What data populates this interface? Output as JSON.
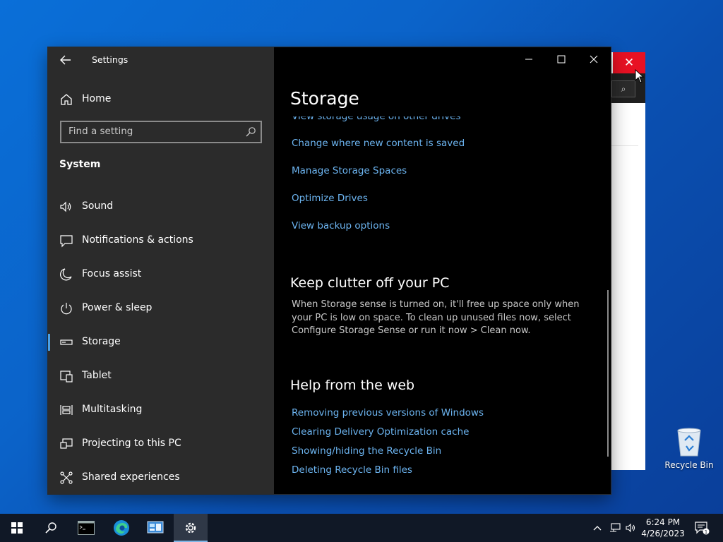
{
  "window": {
    "title": "Settings",
    "minimize_label": "—",
    "maximize_label": "☐",
    "close_label": "✕"
  },
  "sidebar": {
    "home_label": "Home",
    "search_placeholder": "Find a setting",
    "section_title": "System",
    "items": [
      {
        "label": "Sound",
        "icon": "speaker-icon"
      },
      {
        "label": "Notifications & actions",
        "icon": "notification-icon"
      },
      {
        "label": "Focus assist",
        "icon": "moon-icon"
      },
      {
        "label": "Power & sleep",
        "icon": "power-icon"
      },
      {
        "label": "Storage",
        "icon": "storage-icon",
        "active": true
      },
      {
        "label": "Tablet",
        "icon": "tablet-icon"
      },
      {
        "label": "Multitasking",
        "icon": "multitasking-icon"
      },
      {
        "label": "Projecting to this PC",
        "icon": "projecting-icon"
      },
      {
        "label": "Shared experiences",
        "icon": "shared-experiences-icon"
      }
    ]
  },
  "main": {
    "title": "Storage",
    "storage_links": [
      "View storage usage on other drives",
      "Change where new content is saved",
      "Manage Storage Spaces",
      "Optimize Drives",
      "View backup options"
    ],
    "clutter_heading": "Keep clutter off your PC",
    "clutter_text": "When Storage sense is turned on, it'll free up space only when your PC is low on space. To clean up unused files now, select Configure Storage Sense or run it now > Clean now.",
    "help_heading": "Help from the web",
    "help_links": [
      "Removing previous versions of Windows",
      "Clearing Delivery Optimization cache",
      "Showing/hiding the Recycle Bin",
      "Deleting Recycle Bin files"
    ]
  },
  "desktop": {
    "recycle_bin_label": "Recycle Bin"
  },
  "taskbar": {
    "time": "6:24 PM",
    "date": "4/26/2023",
    "notification_count": "1"
  },
  "colors": {
    "accent": "#4aa0e6",
    "link": "#6cb4f0",
    "close_red": "#e81123"
  }
}
